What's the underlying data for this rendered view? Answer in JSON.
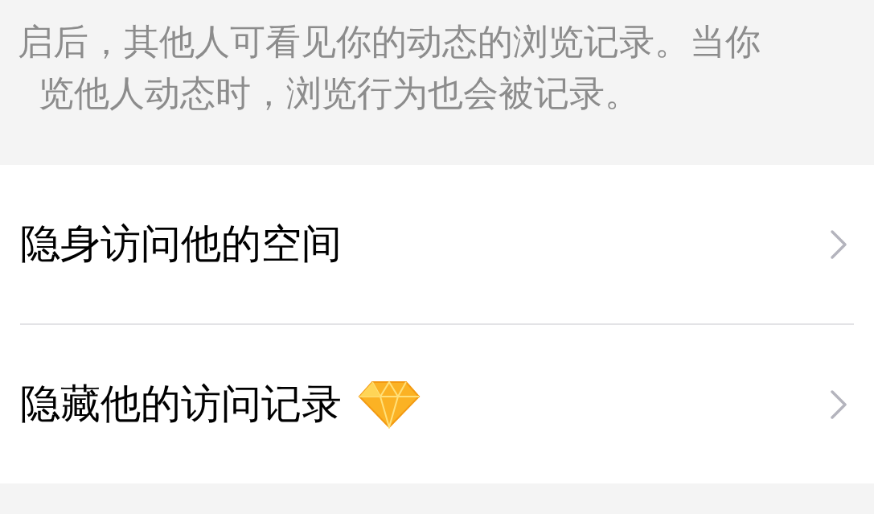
{
  "description_lines": [
    "启后，其他人可看见你的动态的浏览记录。当你",
    "览他人动态时，浏览行为也会被记录。"
  ],
  "items": [
    {
      "label": "隐身访问他的空间",
      "kind": "plain"
    },
    {
      "label": "隐藏他的访问记录",
      "kind": "premium"
    }
  ]
}
